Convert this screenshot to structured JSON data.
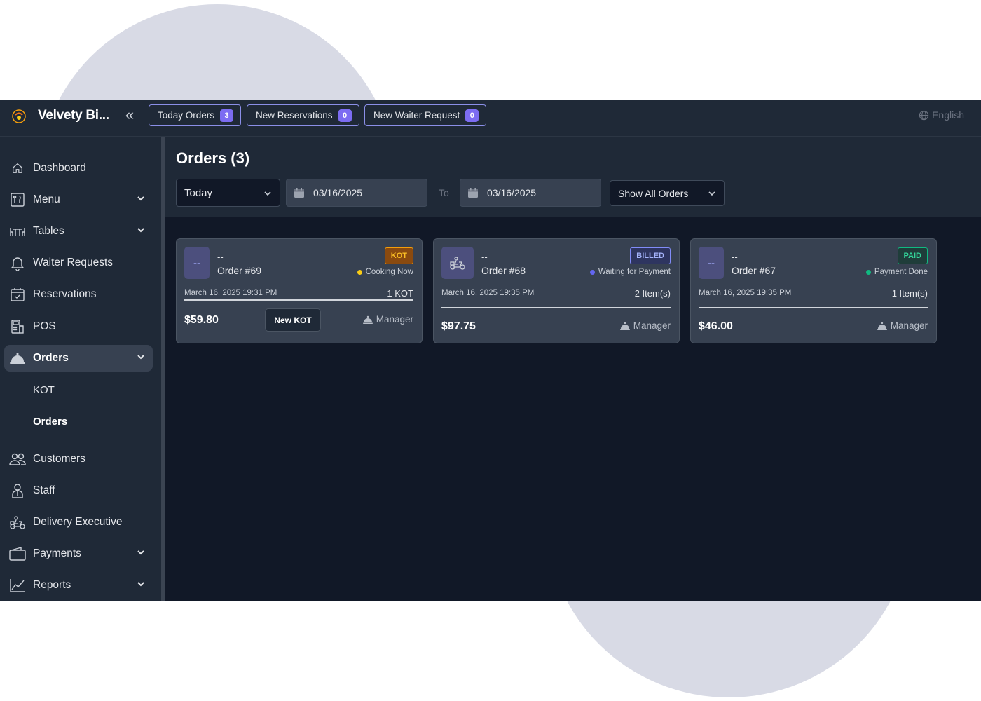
{
  "app": {
    "brand": "Velvety Bi...",
    "collapse_glyph": "«",
    "language": "English"
  },
  "topbar": {
    "pills": [
      {
        "label": "Today Orders",
        "count": "3"
      },
      {
        "label": "New Reservations",
        "count": "0"
      },
      {
        "label": "New Waiter Request",
        "count": "0"
      }
    ]
  },
  "sidebar": {
    "items": [
      {
        "label": "Dashboard",
        "icon": "home-icon"
      },
      {
        "label": "Menu",
        "icon": "menu-book-icon"
      },
      {
        "label": "Tables",
        "icon": "tables-icon"
      },
      {
        "label": "Waiter Requests",
        "icon": "bell-icon"
      },
      {
        "label": "Reservations",
        "icon": "calendar-check-icon"
      },
      {
        "label": "POS",
        "icon": "pos-icon"
      },
      {
        "label": "Orders",
        "icon": "cloche-icon"
      },
      {
        "label": "Customers",
        "icon": "users-icon"
      },
      {
        "label": "Staff",
        "icon": "staff-icon"
      },
      {
        "label": "Delivery Executive",
        "icon": "scooter-icon"
      },
      {
        "label": "Payments",
        "icon": "wallet-icon"
      },
      {
        "label": "Reports",
        "icon": "chart-line-icon"
      }
    ],
    "orders_sub": [
      "KOT",
      "Orders"
    ]
  },
  "main": {
    "title": "Orders (3)",
    "filters": {
      "range": "Today",
      "from_date": "03/16/2025",
      "to_label": "To",
      "to_date": "03/16/2025",
      "order_filter": "Show All Orders"
    }
  },
  "orders": [
    {
      "dash": "--",
      "order_no": "Order #69",
      "badge": "KOT",
      "status": "Cooking Now",
      "status_color": "#facc15",
      "datetime": "March 16, 2025 19:31 PM",
      "items": "1 KOT",
      "amount": "$59.80",
      "staff": "Manager",
      "action": "New KOT"
    },
    {
      "dash": "--",
      "order_no": "Order #68",
      "badge": "BILLED",
      "status": "Waiting for Payment",
      "status_color": "#6366f1",
      "datetime": "March 16, 2025 19:35 PM",
      "items": "2 Item(s)",
      "amount": "$97.75",
      "staff": "Manager"
    },
    {
      "dash": "--",
      "order_no": "Order #67",
      "badge": "PAID",
      "status": "Payment Done",
      "status_color": "#10b981",
      "datetime": "March 16, 2025 19:35 PM",
      "items": "1 Item(s)",
      "amount": "$46.00",
      "staff": "Manager"
    }
  ]
}
